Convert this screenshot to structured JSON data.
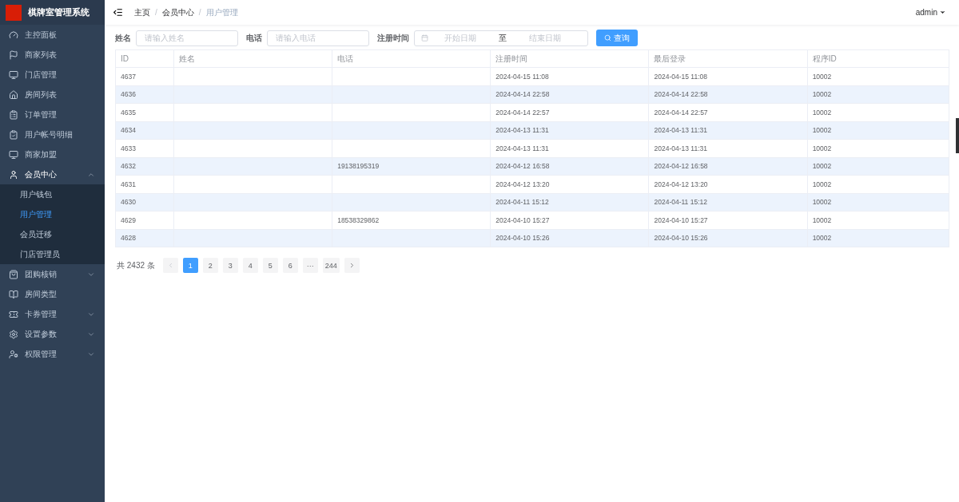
{
  "app": {
    "title": "棋牌室管理系统"
  },
  "sidebar": {
    "items": [
      {
        "label": "主控面板",
        "selected": false
      },
      {
        "label": "商家列表",
        "selected": false
      },
      {
        "label": "门店管理",
        "selected": false
      },
      {
        "label": "房间列表",
        "selected": false
      },
      {
        "label": "订单管理",
        "selected": false
      },
      {
        "label": "用户帐号明细",
        "selected": false
      },
      {
        "label": "商家加盟",
        "selected": false
      },
      {
        "label": "会员中心",
        "selected": false,
        "expanded": true,
        "children": [
          {
            "label": "用户钱包",
            "selected": false
          },
          {
            "label": "用户管理",
            "selected": true
          },
          {
            "label": "会员迁移",
            "selected": false
          },
          {
            "label": "门店管理员",
            "selected": false
          }
        ]
      },
      {
        "label": "团购核销",
        "selected": false,
        "expanded": false
      },
      {
        "label": "房间类型",
        "selected": false
      },
      {
        "label": "卡券管理",
        "selected": false,
        "expanded": false
      },
      {
        "label": "设置参数",
        "selected": false,
        "expanded": false
      },
      {
        "label": "权限管理",
        "selected": false,
        "expanded": false
      }
    ]
  },
  "breadcrumb": [
    {
      "kind": "link",
      "label": "主页"
    },
    {
      "kind": "separator",
      "label": "/"
    },
    {
      "kind": "link",
      "label": "会员中心"
    },
    {
      "kind": "separator",
      "label": "/"
    },
    {
      "kind": "current",
      "label": "用户管理"
    }
  ],
  "user": {
    "name": "admin"
  },
  "filters": {
    "name": {
      "label": "姓名",
      "placeholder": "请输入姓名"
    },
    "phone": {
      "label": "电话",
      "placeholder": "请输入电话"
    },
    "date": {
      "label": "注册时间",
      "start_placeholder": "开始日期",
      "separator": "至",
      "end_placeholder": "结束日期"
    },
    "search_button": "查询"
  },
  "table": {
    "columns": [
      "ID",
      "姓名",
      "电话",
      "注册时间",
      "最后登录",
      "程序ID"
    ],
    "rows": [
      [
        "4637",
        "",
        "",
        "2024-04-15 11:08",
        "2024-04-15 11:08",
        "10002"
      ],
      [
        "4636",
        "",
        "",
        "2024-04-14 22:58",
        "2024-04-14 22:58",
        "10002"
      ],
      [
        "4635",
        "",
        "",
        "2024-04-14 22:57",
        "2024-04-14 22:57",
        "10002"
      ],
      [
        "4634",
        "",
        "",
        "2024-04-13 11:31",
        "2024-04-13 11:31",
        "10002"
      ],
      [
        "4633",
        "",
        "",
        "2024-04-13 11:31",
        "2024-04-13 11:31",
        "10002"
      ],
      [
        "4632",
        "",
        "19138195319",
        "2024-04-12 16:58",
        "2024-04-12 16:58",
        "10002"
      ],
      [
        "4631",
        "",
        "",
        "2024-04-12 13:20",
        "2024-04-12 13:20",
        "10002"
      ],
      [
        "4630",
        "",
        "",
        "2024-04-11 15:12",
        "2024-04-11 15:12",
        "10002"
      ],
      [
        "4629",
        "",
        "18538329862",
        "2024-04-10 15:27",
        "2024-04-10 15:27",
        "10002"
      ],
      [
        "4628",
        "",
        "",
        "2024-04-10 15:26",
        "2024-04-10 15:26",
        "10002"
      ]
    ]
  },
  "pagination": {
    "total": "共 2432 条",
    "pages": [
      {
        "label": "1",
        "selected": true
      },
      {
        "label": "2",
        "selected": false
      },
      {
        "label": "3",
        "selected": false
      },
      {
        "label": "4",
        "selected": false
      },
      {
        "label": "5",
        "selected": false
      },
      {
        "label": "6",
        "selected": false
      },
      {
        "label": "···",
        "selected": false
      },
      {
        "label": "244",
        "selected": false
      }
    ]
  }
}
